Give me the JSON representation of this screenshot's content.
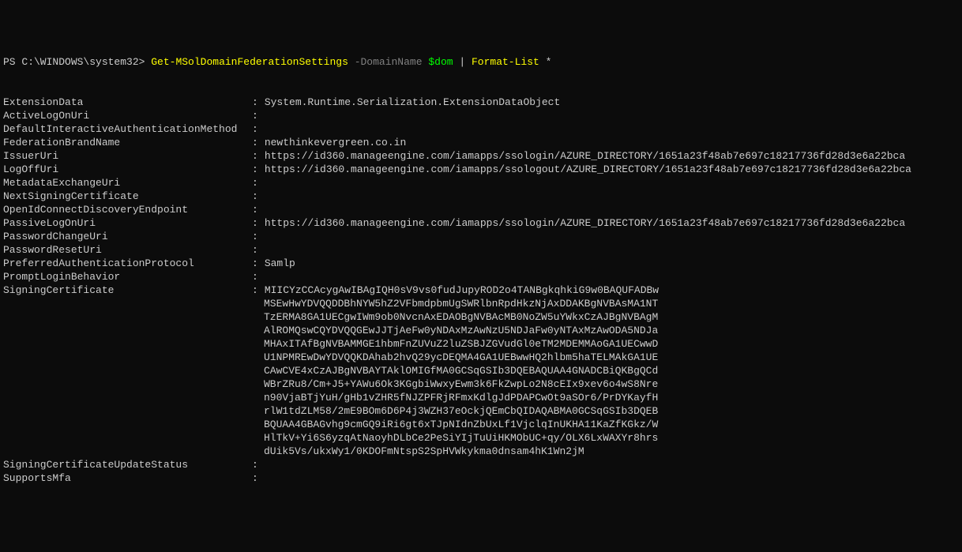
{
  "prompt": {
    "ps": "PS ",
    "path": "C:\\WINDOWS\\system32>",
    "cmdlet": "Get-MSolDomainFederationSettings",
    "param": "-DomainName",
    "variable": "$dom",
    "pipe": "|",
    "format_cmd": "Format-List",
    "format_arg": "*"
  },
  "output": {
    "colon": ":",
    "props": [
      {
        "name": "ExtensionData",
        "value": "System.Runtime.Serialization.ExtensionDataObject"
      },
      {
        "name": "ActiveLogOnUri",
        "value": ""
      },
      {
        "name": "DefaultInteractiveAuthenticationMethod",
        "value": ""
      },
      {
        "name": "FederationBrandName",
        "value": "newthinkevergreen.co.in"
      },
      {
        "name": "IssuerUri",
        "value": "https://id360.manageengine.com/iamapps/ssologin/AZURE_DIRECTORY/1651a23f48ab7e697c18217736fd28d3e6a22bca"
      },
      {
        "name": "LogOffUri",
        "value": "https://id360.manageengine.com/iamapps/ssologout/AZURE_DIRECTORY/1651a23f48ab7e697c18217736fd28d3e6a22bca"
      },
      {
        "name": "MetadataExchangeUri",
        "value": ""
      },
      {
        "name": "NextSigningCertificate",
        "value": ""
      },
      {
        "name": "OpenIdConnectDiscoveryEndpoint",
        "value": ""
      },
      {
        "name": "PassiveLogOnUri",
        "value": "https://id360.manageengine.com/iamapps/ssologin/AZURE_DIRECTORY/1651a23f48ab7e697c18217736fd28d3e6a22bca"
      },
      {
        "name": "PasswordChangeUri",
        "value": ""
      },
      {
        "name": "PasswordResetUri",
        "value": ""
      },
      {
        "name": "PreferredAuthenticationProtocol",
        "value": "Samlp"
      },
      {
        "name": "PromptLoginBehavior",
        "value": ""
      }
    ],
    "cert_prop": "SigningCertificate",
    "cert_lines": [
      "MIICYzCCAcygAwIBAgIQH0sV9vs0fudJupyROD2o4TANBgkqhkiG9w0BAQUFADBw",
      "MSEwHwYDVQQDDBhNYW5hZ2VFbmdpbmUgSWRlbnRpdHkzNjAxDDAKBgNVBAsMA1NT",
      "TzERMA8GA1UECgwIWm9ob0NvcnAxEDAOBgNVBAcMB0NoZW5uYWkxCzAJBgNVBAgM",
      "AlROMQswCQYDVQQGEwJJTjAeFw0yNDAxMzAwNzU5NDJaFw0yNTAxMzAwODA5NDJa",
      "MHAxITAfBgNVBAMMGE1hbmFnZUVuZ2luZSBJZGVudGl0eTM2MDEMMAoGA1UECwwD",
      "U1NPMREwDwYDVQQKDAhab2hvQ29ycDEQMA4GA1UEBwwHQ2hlbm5haTELMAkGA1UE",
      "CAwCVE4xCzAJBgNVBAYTAklOMIGfMA0GCSqGSIb3DQEBAQUAA4GNADCBiQKBgQCd",
      "WBrZRu8/Cm+J5+YAWu6Ok3KGgbiWwxyEwm3k6FkZwpLo2N8cEIx9xev6o4wS8Nre",
      "n90VjaBTjYuH/gHb1vZHR5fNJZPFRjRFmxKdlgJdPDAPCwOt9aSOr6/PrDYKayfH",
      "rlW1tdZLM58/2mE9BOm6D6P4j3WZH37eOckjQEmCbQIDAQABMA0GCSqGSIb3DQEB",
      "BQUAA4GBAGvhg9cmGQ9iRi6gt6xTJpNIdnZbUxLf1VjclqInUKHA11KaZfKGkz/W",
      "HlTkV+Yi6S6yzqAtNaoyhDLbCe2PeSiYIjTuUiHKMObUC+qy/OLX6LxWAXYr8hrs",
      "dUik5Vs/ukxWy1/0KDOFmNtspS2SpHVWkykma0dnsam4hK1Wn2jM"
    ],
    "tail_props": [
      {
        "name": "SigningCertificateUpdateStatus",
        "value": ""
      },
      {
        "name": "SupportsMfa",
        "value": ""
      }
    ]
  }
}
